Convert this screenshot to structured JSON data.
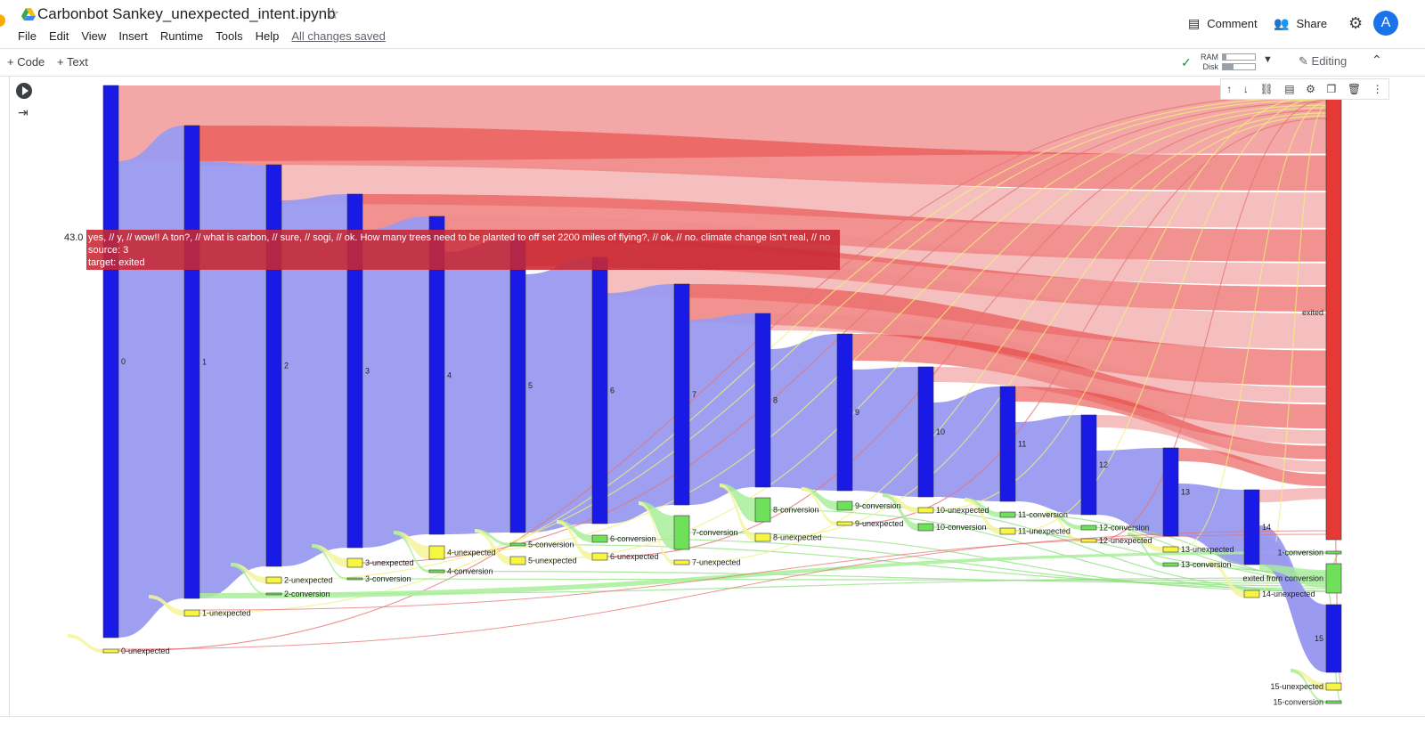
{
  "header": {
    "title": "Carbonbot Sankey_unexpected_intent.ipynb",
    "menu": [
      "File",
      "Edit",
      "View",
      "Insert",
      "Runtime",
      "Tools",
      "Help"
    ],
    "saved_status": "All changes saved",
    "comment_label": "Comment",
    "share_label": "Share",
    "avatar_letter": "A"
  },
  "toolbar": {
    "add_code": "+ Code",
    "add_text": "+ Text",
    "ram_label": "RAM",
    "disk_label": "Disk",
    "editing_label": "Editing"
  },
  "tooltip": {
    "value": "43.0",
    "line1": "yes, // y, // wow!! A ton?, // what is  carbon, // sure, // sogi, // ok.  How many trees need to be planted to off set 2200 miles of flying?, // ok, // no. climate change isn't real, // no",
    "line2": "source: 3",
    "line3": "target: exited"
  },
  "chart_data": {
    "type": "sankey",
    "colors": {
      "step": "#1a1ae6",
      "unexpected": "#f5f542",
      "conversion": "#6ee05a",
      "exited": "#e53935",
      "flow_step": "#9a9af0",
      "flow_exit": "#ef8a8a",
      "flow_conv": "#a8ee9a",
      "flow_unexp": "#f5f59a"
    },
    "nodes": [
      {
        "name": "0",
        "kind": "step"
      },
      {
        "name": "1",
        "kind": "step"
      },
      {
        "name": "2",
        "kind": "step"
      },
      {
        "name": "3",
        "kind": "step"
      },
      {
        "name": "4",
        "kind": "step"
      },
      {
        "name": "5",
        "kind": "step"
      },
      {
        "name": "6",
        "kind": "step"
      },
      {
        "name": "7",
        "kind": "step"
      },
      {
        "name": "8",
        "kind": "step"
      },
      {
        "name": "9",
        "kind": "step"
      },
      {
        "name": "10",
        "kind": "step"
      },
      {
        "name": "11",
        "kind": "step"
      },
      {
        "name": "12",
        "kind": "step"
      },
      {
        "name": "13",
        "kind": "step"
      },
      {
        "name": "14",
        "kind": "step"
      },
      {
        "name": "15",
        "kind": "step"
      },
      {
        "name": "exited",
        "kind": "exited"
      },
      {
        "name": "exited from conversion",
        "kind": "conversion"
      },
      {
        "name": "0-unexpected",
        "kind": "unexpected"
      },
      {
        "name": "1-unexpected",
        "kind": "unexpected"
      },
      {
        "name": "2-unexpected",
        "kind": "unexpected"
      },
      {
        "name": "2-conversion",
        "kind": "conversion"
      },
      {
        "name": "3-unexpected",
        "kind": "unexpected"
      },
      {
        "name": "3-conversion",
        "kind": "conversion"
      },
      {
        "name": "4-unexpected",
        "kind": "unexpected"
      },
      {
        "name": "4-conversion",
        "kind": "conversion"
      },
      {
        "name": "5-conversion",
        "kind": "conversion"
      },
      {
        "name": "5-unexpected",
        "kind": "unexpected"
      },
      {
        "name": "6-conversion",
        "kind": "conversion"
      },
      {
        "name": "6-unexpected",
        "kind": "unexpected"
      },
      {
        "name": "7-conversion",
        "kind": "conversion"
      },
      {
        "name": "7-unexpected",
        "kind": "unexpected"
      },
      {
        "name": "8-conversion",
        "kind": "conversion"
      },
      {
        "name": "8-unexpected",
        "kind": "unexpected"
      },
      {
        "name": "9-conversion",
        "kind": "conversion"
      },
      {
        "name": "9-unexpected",
        "kind": "unexpected"
      },
      {
        "name": "10-unexpected",
        "kind": "unexpected"
      },
      {
        "name": "10-conversion",
        "kind": "conversion"
      },
      {
        "name": "11-conversion",
        "kind": "conversion"
      },
      {
        "name": "11-unexpected",
        "kind": "unexpected"
      },
      {
        "name": "12-conversion",
        "kind": "conversion"
      },
      {
        "name": "12-unexpected",
        "kind": "unexpected"
      },
      {
        "name": "13-unexpected",
        "kind": "unexpected"
      },
      {
        "name": "13-conversion",
        "kind": "conversion"
      },
      {
        "name": "1-conversion",
        "kind": "conversion"
      },
      {
        "name": "14-unexpected",
        "kind": "unexpected"
      },
      {
        "name": "15-unexpected",
        "kind": "unexpected"
      },
      {
        "name": "15-conversion",
        "kind": "conversion"
      }
    ],
    "hover_link": {
      "source": "3",
      "target": "exited",
      "value": 43.0
    }
  }
}
